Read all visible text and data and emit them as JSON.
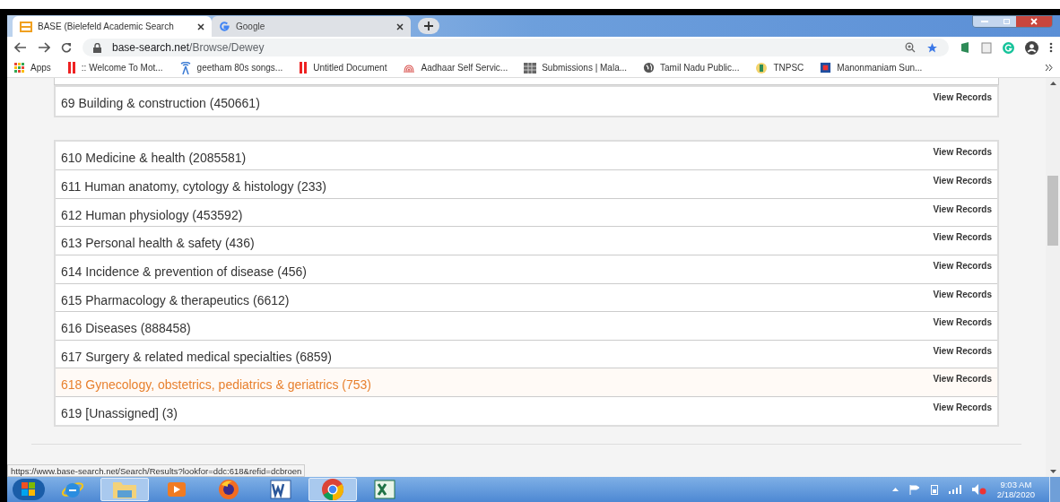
{
  "window": {
    "tabs": [
      {
        "title": "BASE (Bielefeld Academic Search",
        "selected": true
      },
      {
        "title": "Google",
        "selected": false
      }
    ]
  },
  "address_bar": {
    "domain": "base-search.net",
    "path": "/Browse/Dewey"
  },
  "bookmarks": [
    {
      "label": "Apps"
    },
    {
      "label": ":: Welcome To Mot..."
    },
    {
      "label": "geetham 80s songs..."
    },
    {
      "label": "Untitled Document"
    },
    {
      "label": "Aadhaar Self Servic..."
    },
    {
      "label": "Submissions | Mala..."
    },
    {
      "label": "Tamil Nadu Public..."
    },
    {
      "label": "TNPSC"
    },
    {
      "label": "Manonmaniam Sun..."
    }
  ],
  "groups": [
    {
      "rows": [
        {
          "label": "69 Building & construction (450661)",
          "action": "View Records",
          "highlighted": false
        }
      ]
    },
    {
      "rows": [
        {
          "label": "610 Medicine & health (2085581)",
          "action": "View Records",
          "highlighted": false
        },
        {
          "label": "611 Human anatomy, cytology & histology (233)",
          "action": "View Records",
          "highlighted": false
        },
        {
          "label": "612 Human physiology (453592)",
          "action": "View Records",
          "highlighted": false
        },
        {
          "label": "613 Personal health & safety (436)",
          "action": "View Records",
          "highlighted": false
        },
        {
          "label": "614 Incidence & prevention of disease (456)",
          "action": "View Records",
          "highlighted": false
        },
        {
          "label": "615 Pharmacology & therapeutics (6612)",
          "action": "View Records",
          "highlighted": false
        },
        {
          "label": "616 Diseases (888458)",
          "action": "View Records",
          "highlighted": false
        },
        {
          "label": "617 Surgery & related medical specialties (6859)",
          "action": "View Records",
          "highlighted": false
        },
        {
          "label": "618 Gynecology, obstetrics, pediatrics & geriatrics (753)",
          "action": "View Records",
          "highlighted": true
        },
        {
          "label": "619 [Unassigned] (3)",
          "action": "View Records",
          "highlighted": false
        }
      ]
    }
  ],
  "status_url": "https://www.base-search.net/Search/Results?lookfor=ddc:618&refid=dcbroen",
  "taskbar": {
    "apps": [
      {
        "selected": false
      },
      {
        "selected": true
      },
      {
        "selected": false
      },
      {
        "selected": false
      },
      {
        "selected": false
      },
      {
        "selected": true
      },
      {
        "selected": false
      }
    ],
    "time": "9:03 AM",
    "date": "2/18/2020"
  }
}
